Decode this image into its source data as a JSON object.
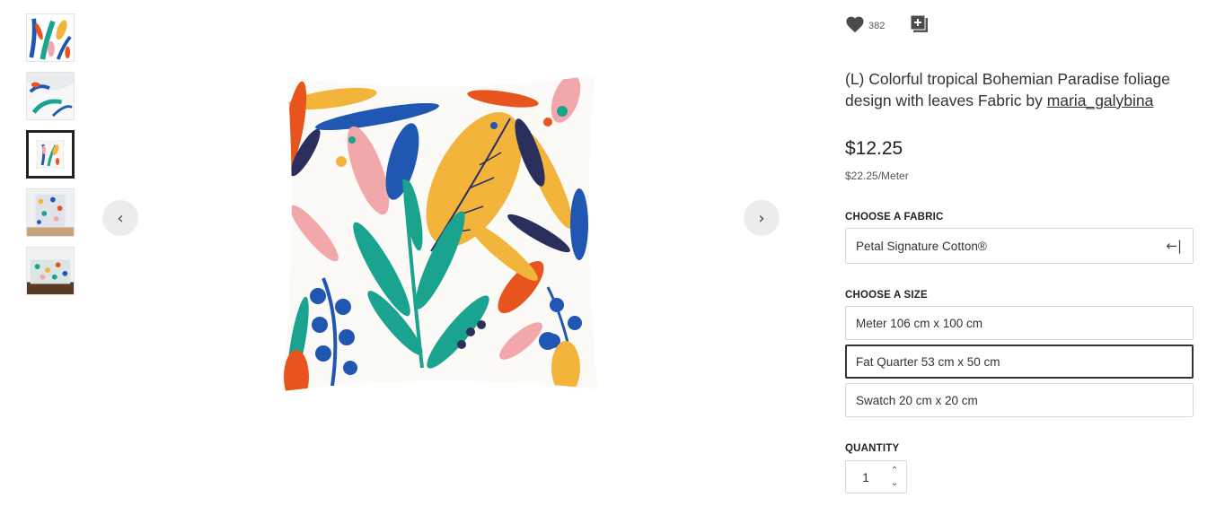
{
  "gallery": {
    "thumbnails": [
      {
        "alt": "fabric swatch"
      },
      {
        "alt": "fabric drape"
      },
      {
        "alt": "pillow"
      },
      {
        "alt": "curtain"
      },
      {
        "alt": "bedding"
      }
    ],
    "selected_index": 2,
    "prev_icon": "chevron-left-icon",
    "next_icon": "chevron-right-icon",
    "prev_glyph": "‹",
    "next_glyph": "›"
  },
  "product": {
    "favorites_count": "382",
    "title": "(L) Colorful tropical Bohemian Paradise foliage design with leaves Fabric by ",
    "designer": "maria_galybina",
    "price": "$12.25",
    "unit_price": "$22.25/Meter"
  },
  "fabric": {
    "label": "CHOOSE A FABRIC",
    "selected": "Petal Signature Cotton®",
    "arrow_glyph": "←|"
  },
  "size": {
    "label": "CHOOSE A SIZE",
    "options": [
      "Meter 106 cm x 100 cm",
      "Fat Quarter 53 cm x 50 cm",
      "Swatch 20 cm x 20 cm"
    ],
    "selected_index": 1
  },
  "quantity": {
    "label": "QUANTITY",
    "value": "1",
    "up_glyph": "⌃",
    "down_glyph": "⌄"
  },
  "colors": {
    "teal": "#1aa38f",
    "blue": "#1f57b3",
    "orange": "#e8541d",
    "yellow": "#f3b43b",
    "pink": "#f2a8ab",
    "navy": "#2a2f5e"
  }
}
